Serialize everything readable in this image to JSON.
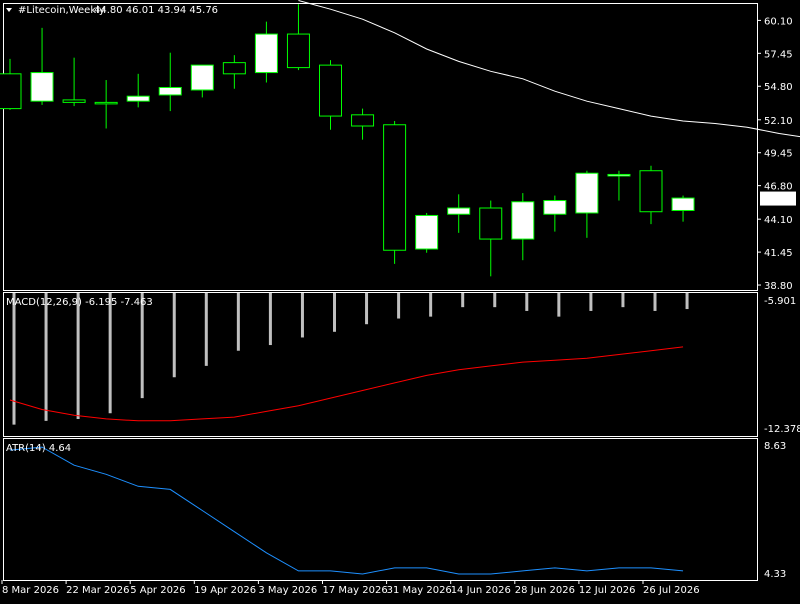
{
  "colors": {
    "background": "#000000",
    "frame": "#ffffff",
    "text": "#ffffff",
    "candle_outline": "#00ff00",
    "candle_body": "#ffffff",
    "moving_average": "#ffffff",
    "macd_histogram": "#c0c0c0",
    "macd_signal": "#ff0000",
    "atr_line": "#1e90ff"
  },
  "icons": {
    "menu": "triangle-down-icon"
  },
  "chart_data": [
    {
      "type": "candlestick",
      "title": "#Litecoin,Weekly",
      "header_values": "44.80 46.01 43.94 45.76",
      "current_price_label": "45.76",
      "y_ticks": [
        "60.10",
        "57.45",
        "54.80",
        "52.10",
        "49.45",
        "46.80",
        "44.10",
        "41.45",
        "38.80"
      ],
      "ylim": [
        38.8,
        61.5
      ],
      "x_ticks": [
        "8 Mar 2026",
        "22 Mar 2026",
        "5 Apr 2026",
        "19 Apr 2026",
        "3 May 2026",
        "17 May 2026",
        "31 May 2026",
        "14 Jun 2026",
        "28 Jun 2026",
        "12 Jul 2026",
        "26 Jul 2026"
      ],
      "candles": [
        {
          "open": 55.8,
          "high": 57.0,
          "low": 52.9,
          "close": 53.0
        },
        {
          "open": 53.6,
          "high": 59.5,
          "low": 53.3,
          "close": 55.9
        },
        {
          "open": 53.7,
          "high": 57.1,
          "low": 53.2,
          "close": 53.5
        },
        {
          "open": 53.5,
          "high": 55.3,
          "low": 51.4,
          "close": 53.4
        },
        {
          "open": 53.6,
          "high": 55.8,
          "low": 53.1,
          "close": 54.0
        },
        {
          "open": 54.1,
          "high": 57.5,
          "low": 52.8,
          "close": 54.7
        },
        {
          "open": 54.5,
          "high": 56.5,
          "low": 53.9,
          "close": 56.5
        },
        {
          "open": 56.7,
          "high": 57.3,
          "low": 54.6,
          "close": 55.8
        },
        {
          "open": 55.9,
          "high": 60.0,
          "low": 55.1,
          "close": 59.0
        },
        {
          "open": 59.0,
          "high": 61.4,
          "low": 56.1,
          "close": 56.3
        },
        {
          "open": 56.5,
          "high": 56.9,
          "low": 51.3,
          "close": 52.4
        },
        {
          "open": 52.5,
          "high": 53.0,
          "low": 50.5,
          "close": 51.6
        },
        {
          "open": 51.7,
          "high": 52.0,
          "low": 40.5,
          "close": 41.6
        },
        {
          "open": 41.7,
          "high": 44.6,
          "low": 41.4,
          "close": 44.4
        },
        {
          "open": 44.5,
          "high": 46.1,
          "low": 43.0,
          "close": 45.0
        },
        {
          "open": 45.0,
          "high": 45.6,
          "low": 39.5,
          "close": 42.5
        },
        {
          "open": 42.5,
          "high": 46.2,
          "low": 40.8,
          "close": 45.5
        },
        {
          "open": 44.5,
          "high": 46.0,
          "low": 43.1,
          "close": 45.6
        },
        {
          "open": 44.6,
          "high": 48.0,
          "low": 42.6,
          "close": 47.8
        },
        {
          "open": 47.7,
          "high": 48.0,
          "low": 45.6,
          "close": 47.7
        },
        {
          "open": 48.0,
          "high": 48.4,
          "low": 43.7,
          "close": 44.7
        },
        {
          "open": 44.8,
          "high": 46.0,
          "low": 43.9,
          "close": 45.8
        }
      ],
      "moving_average": [
        61.7,
        61.0,
        60.2,
        59.1,
        57.8,
        56.8,
        56.0,
        55.4,
        54.4,
        53.6,
        53.0,
        52.4,
        52.0,
        51.8,
        51.5,
        51.0,
        50.6
      ]
    },
    {
      "type": "bar+line",
      "title": "MACD(12,26,9) -6.195 -7.463",
      "y_ticks": [
        "-5.901",
        "-12.378"
      ],
      "ylim": [
        -12.378,
        -5.901
      ],
      "histogram": [
        -12.2,
        -12.0,
        -11.9,
        -11.6,
        -10.8,
        -9.7,
        -9.1,
        -8.3,
        -8.0,
        -7.6,
        -7.3,
        -6.9,
        -6.6,
        -6.5,
        -6.0,
        -6.0,
        -6.2,
        -6.5,
        -6.2,
        -6.0,
        -6.2,
        -6.1
      ],
      "signal": [
        -10.9,
        -11.4,
        -11.7,
        -11.9,
        -12.0,
        -12.0,
        -11.9,
        -11.8,
        -11.5,
        -11.2,
        -10.8,
        -10.4,
        -10.0,
        -9.6,
        -9.3,
        -9.1,
        -8.9,
        -8.8,
        -8.7,
        -8.5,
        -8.3,
        -8.1
      ]
    },
    {
      "type": "line",
      "title": "ATR(14) 4.64",
      "y_ticks": [
        "8.63",
        "4.33"
      ],
      "ylim": [
        4.33,
        8.63
      ],
      "series": [
        {
          "values": [
            8.5,
            8.6,
            8.0,
            7.7,
            7.3,
            7.2,
            6.5,
            5.8,
            5.1,
            4.5,
            4.5,
            4.4,
            4.6,
            4.6,
            4.4,
            4.4,
            4.5,
            4.6,
            4.5,
            4.6,
            4.6,
            4.5
          ]
        }
      ]
    }
  ]
}
